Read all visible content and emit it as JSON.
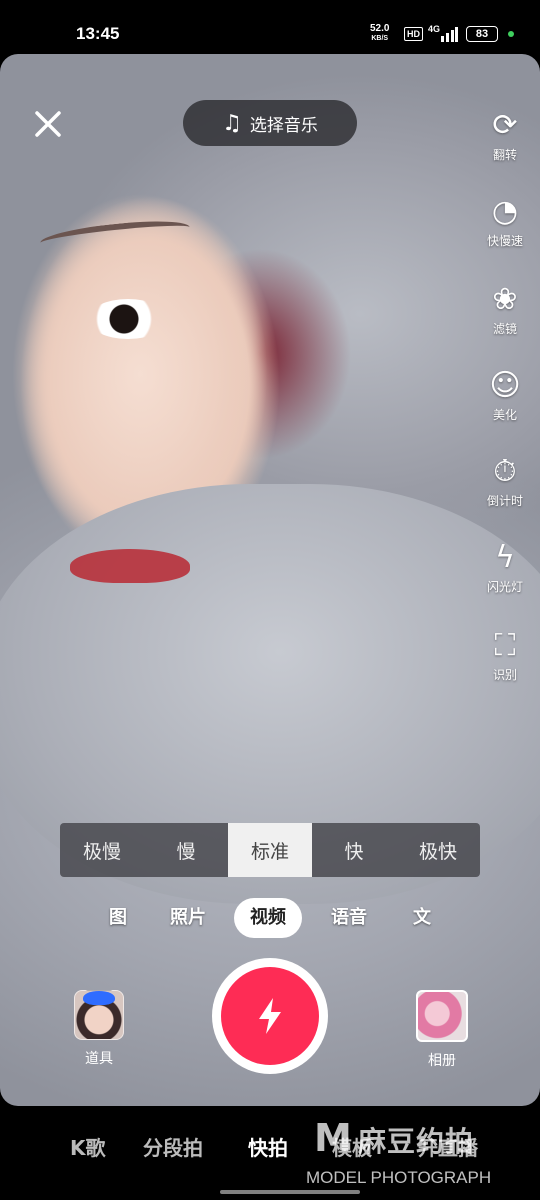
{
  "status_bar": {
    "time": "13:45",
    "net_speed_value": "52.0",
    "net_speed_unit": "KB/S",
    "hd_badge": "HD",
    "network": "4G",
    "battery": "83"
  },
  "top": {
    "music_label": "选择音乐"
  },
  "side_tools": [
    {
      "label": "翻转",
      "icon": "flip-camera-icon"
    },
    {
      "label": "快慢速",
      "icon": "speed-gauge-icon"
    },
    {
      "label": "滤镜",
      "icon": "filter-icon"
    },
    {
      "label": "美化",
      "icon": "beautify-icon"
    },
    {
      "label": "倒计时",
      "icon": "countdown-timer-icon"
    },
    {
      "label": "闪光灯",
      "icon": "flash-off-icon"
    },
    {
      "label": "识别",
      "icon": "scan-recognize-icon"
    }
  ],
  "speed": {
    "options": [
      "极慢",
      "慢",
      "标准",
      "快",
      "极快"
    ],
    "selected": "标准"
  },
  "modes": {
    "items": [
      "图",
      "照片",
      "视频",
      "语音",
      "文"
    ],
    "selected": "视频"
  },
  "capture": {
    "props_label": "道具",
    "album_label": "相册"
  },
  "bottom_nav": {
    "items": [
      "K歌",
      "分段拍",
      "快拍",
      "模板",
      "开直播"
    ],
    "selected": "快拍"
  },
  "watermark": {
    "logo": "M",
    "chinese": "麻豆约拍",
    "english": "MODEL PHOTOGRAPH"
  },
  "colors": {
    "record_red": "#fe2c55",
    "accent_green": "#3fcf5e"
  }
}
